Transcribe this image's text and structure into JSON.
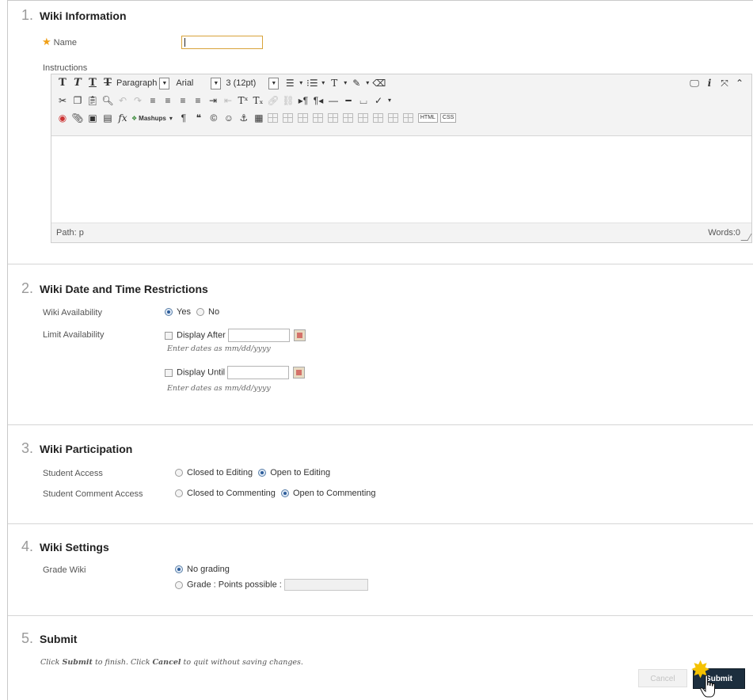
{
  "sections": {
    "wiki_info": {
      "number": "1.",
      "title": "Wiki Information"
    },
    "dates": {
      "number": "2.",
      "title": "Wiki Date and Time Restrictions"
    },
    "participation": {
      "number": "3.",
      "title": "Wiki Participation"
    },
    "settings": {
      "number": "4.",
      "title": "Wiki Settings"
    },
    "submit": {
      "number": "5.",
      "title": "Submit"
    }
  },
  "wiki_info": {
    "name_label": "Name",
    "name_value": "",
    "instructions_label": "Instructions"
  },
  "editor": {
    "format_select": "Paragraph",
    "font_select": "Arial",
    "size_select": "3 (12pt)",
    "mashups_label": "Mashups",
    "html_label": "HTML",
    "css_label": "CSS",
    "path_label": "Path: p",
    "words_label": "Words:0"
  },
  "dates": {
    "availability_label": "Wiki Availability",
    "yes_label": "Yes",
    "no_label": "No",
    "availability_selected": "Yes",
    "limit_label": "Limit Availability",
    "display_after_label": "Display After",
    "display_until_label": "Display Until",
    "date_hint_1": "Enter dates as mm/dd/yyyy",
    "date_hint_2": "Enter dates as mm/dd/yyyy"
  },
  "participation": {
    "student_access_label": "Student Access",
    "closed_editing": "Closed to Editing",
    "open_editing": "Open to Editing",
    "comment_access_label": "Student Comment Access",
    "closed_commenting": "Closed to Commenting",
    "open_commenting": "Open to Commenting"
  },
  "settings": {
    "grade_label": "Grade Wiki",
    "no_grading": "No grading",
    "grade_points": "Grade : Points possible :"
  },
  "submit": {
    "note_pre": "Click ",
    "note_submit": "Submit",
    "note_mid": " to finish. Click ",
    "note_cancel": "Cancel",
    "note_post": " to quit without saving changes.",
    "cancel_button": "Cancel",
    "submit_button": "Submit"
  },
  "colors": {
    "required_star": "#f0a018",
    "submit_bg": "#1c2e3e",
    "focus_border": "#d8a33a"
  }
}
